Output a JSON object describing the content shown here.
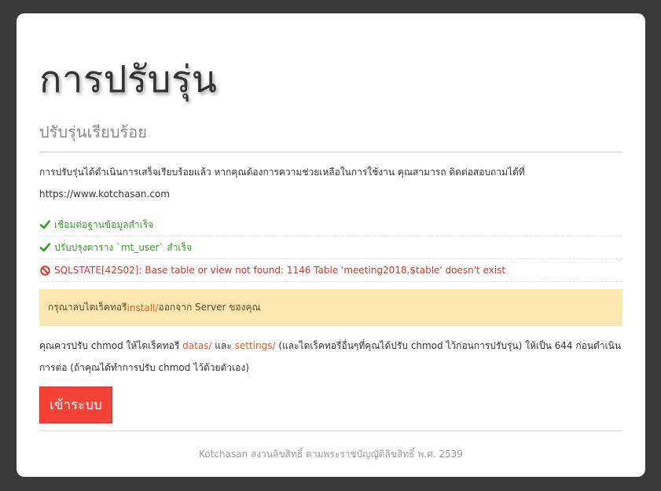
{
  "page": {
    "title": "การปรับรุ่น",
    "subtitle": "ปรับรุ่นเรียบร้อย"
  },
  "intro": {
    "line1": "การปรับรุ่นได้ดำเนินการเสร็จเรียบร้อยแล้ว หากคุณต้องการความช่วยเหลือในการใช้งาน คุณสามารถ ติดต่อสอบถามได้ที่",
    "url": "https://www.kotchasan.com"
  },
  "status_items": [
    {
      "type": "success",
      "icon": "check-icon",
      "text": "เชื่อมต่อฐานข้อมูลสำเร็จ"
    },
    {
      "type": "success",
      "icon": "check-icon",
      "text": "ปรับปรุงตาราง `mt_user` สำเร็จ"
    },
    {
      "type": "error",
      "icon": "ban-icon",
      "text": "SQLSTATE[42S02]: Base table or view not found: 1146 Table 'meeting2018.$table' doesn't exist"
    }
  ],
  "warning": {
    "before": "กรุณาลบไดเร็คทอรี ",
    "dir": "install/",
    "after": " ออกจาก Server ของคุณ"
  },
  "chmod_note": {
    "part1": "คุณควรปรับ chmod ให้ไดเร็คทอรี ",
    "dir1": "datas/",
    "part2": " และ ",
    "dir2": "settings/",
    "part3": " (และไดเร็คทอรี่อื่นๆที่คุณได้ปรับ chmod ไว้ก่อนการปรับรุ่น) ให้เป็น 644 ก่อนดำเนิน",
    "line2": "การต่อ (ถ้าคุณได้ทำการปรับ chmod ไว้ด้วยตัวเอง)"
  },
  "login_button": {
    "label": "เข้าระบบ"
  },
  "footer": {
    "text": "Kotchasan สงวนลิขสิทธิ์ ตามพระราชบัญญัติลิขสิทธิ์ พ.ศ. 2539"
  },
  "colors": {
    "success": "#3a9a2a",
    "error": "#e0302a",
    "warning_bg": "#fce7b1",
    "button": "#f44336",
    "link": "#f0552f"
  }
}
